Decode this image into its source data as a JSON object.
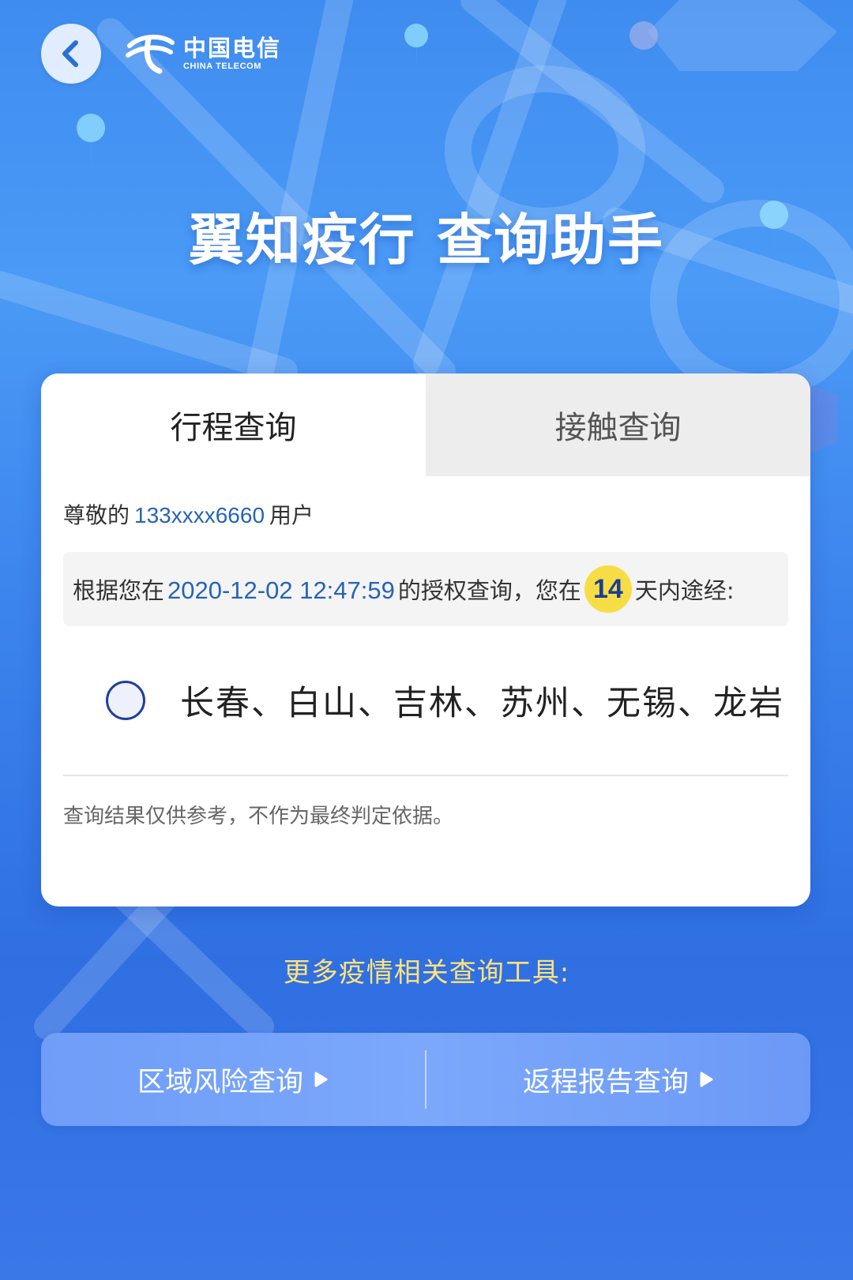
{
  "header": {
    "back_icon": "chevron-left-icon",
    "logo": {
      "cn": "中国电信",
      "en": "CHINA TELECOM",
      "icon": "china-telecom-logo-icon"
    }
  },
  "title": "翼知疫行 查询助手",
  "tabs": [
    {
      "label": "行程查询",
      "active": true
    },
    {
      "label": "接触查询",
      "active": false
    }
  ],
  "greeting": {
    "prefix": "尊敬的",
    "phone": "133xxxx6660",
    "suffix": "用户"
  },
  "info": {
    "prefix": "根据您在",
    "datetime": "2020-12-02 12:47:59",
    "middle": "的授权查询，您在",
    "days": "14",
    "suffix": "天内途经:"
  },
  "cities": "长春、白山、吉林、苏州、无锡、龙岩",
  "disclaimer": "查询结果仅供参考，不作为最终判定依据。",
  "more_tools": {
    "title": "更多疫情相关查询工具:",
    "buttons": [
      {
        "label": "区域风险查询",
        "icon": "play-arrow-icon"
      },
      {
        "label": "返程报告查询",
        "icon": "play-arrow-icon"
      }
    ]
  },
  "colors": {
    "accent_blue": "#2563b8",
    "badge_yellow": "#f7dd45",
    "tools_title": "#ffe27a",
    "radio_border": "#1e3f9a"
  }
}
